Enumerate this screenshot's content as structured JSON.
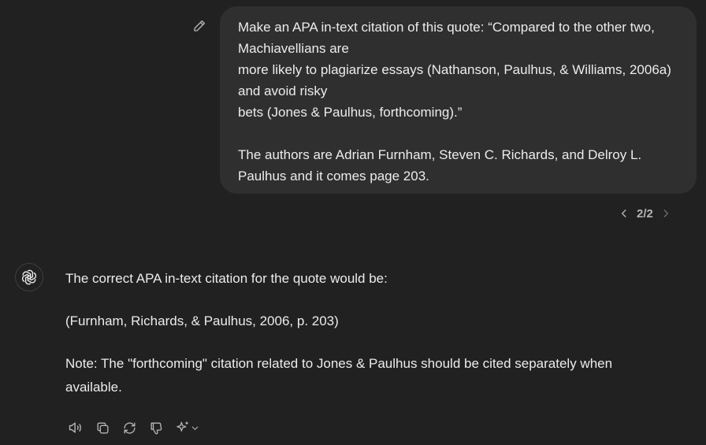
{
  "user_message": {
    "paragraph_1": "Make an APA in-text citation of this quote: “Compared to the other two, Machiavellians are\nmore likely to plagiarize essays (Nathanson, Paulhus, & Williams, 2006a) and avoid risky\nbets (Jones & Paulhus, forthcoming).”",
    "paragraph_2": "The authors are Adrian Furnham, Steven C. Richards, and Delroy L. Paulhus and it comes page 203."
  },
  "pager": {
    "label": "2/2",
    "prev_icon": "chevron-left-icon",
    "next_icon": "chevron-right-icon"
  },
  "assistant_message": {
    "paragraph_1": "The correct APA in-text citation for the quote would be:",
    "paragraph_2": "(Furnham, Richards, & Paulhus, 2006, p. 203)",
    "paragraph_3": "Note: The \"forthcoming\" citation related to Jones & Paulhus should be cited separately when available."
  },
  "icons": {
    "edit": "pencil-icon",
    "avatar": "openai-logo-icon",
    "actions": [
      "speaker-icon",
      "copy-icon",
      "regenerate-icon",
      "thumbs-down-icon",
      "sparkle-model-icon"
    ]
  },
  "colors": {
    "background": "#212121",
    "bubble": "#2f2f2f",
    "text": "#ececec",
    "muted": "#b4b4b4"
  }
}
